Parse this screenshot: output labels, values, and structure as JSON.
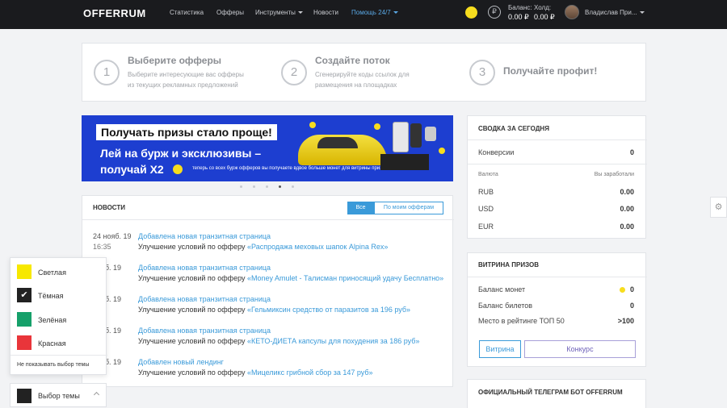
{
  "nav": {
    "logo": "OFFERRUM",
    "items": [
      {
        "label": "Статистика"
      },
      {
        "label": "Офферы"
      },
      {
        "label": "Инструменты"
      },
      {
        "label": "Новости"
      },
      {
        "label": "Помощь 24/7"
      }
    ],
    "balance_label": "Баланс:",
    "balance_value": "0.00 ₽",
    "hold_label": "Холд:",
    "hold_value": "0.00 ₽",
    "ruble_symbol": "₽",
    "user_name": "Владислав При...",
    "accent_color": "#5aa9e6"
  },
  "steps": [
    {
      "num": "1",
      "title": "Выберите офферы",
      "desc1": "Выберите интересующие вас офферы",
      "desc2": "из текущих рекламных предложений"
    },
    {
      "num": "2",
      "title": "Создайте поток",
      "desc1": "Сгенерируйте коды ссылок для",
      "desc2": "размещения на площадках"
    },
    {
      "num": "3",
      "title": "Получайте профит!",
      "desc1": "",
      "desc2": ""
    }
  ],
  "banner": {
    "headline": "Получать призы стало проще!",
    "line1": "Лей на бурж и эксклюзивы –",
    "line2": "получай X2",
    "small": "теперь со всех бурж офферов вы получаете вдвое больше монет для витрины призов",
    "slide_count": 5,
    "active_slide": 4
  },
  "news": {
    "title": "НОВОСТИ",
    "filter_all": "Все",
    "filter_mine": "По моим офферам",
    "items": [
      {
        "date": "24 нояб. 19",
        "time": "16:35",
        "title": "Добавлена новая транзитная страница",
        "prefix": "Улучшение условий по офферу ",
        "offer": "«Распродажа меховых шапок Alpina Rex»"
      },
      {
        "date": "нояб. 19",
        "time": "4",
        "title": "Добавлена новая транзитная страница",
        "prefix": "Улучшение условий по офферу ",
        "offer": "«Money Amulet - Талисман приносящий удачу Бесплатно»"
      },
      {
        "date": "нояб. 19",
        "time": "4",
        "title": "Добавлена новая транзитная страница",
        "prefix": "Улучшение условий по офферу ",
        "offer": "«Гельмиксин средство от паразитов за 196 руб»"
      },
      {
        "date": "нояб. 19",
        "time": "4",
        "title": "Добавлена новая транзитная страница",
        "prefix": "Улучшение условий по офферу ",
        "offer": "«КЕТО-ДИЕТА капсулы для похудения за 186 руб»"
      },
      {
        "date": "нояб. 19",
        "time": "4",
        "title": "Добавлен новый лендинг",
        "prefix": "Улучшение условий по офферу ",
        "offer": "«Мицеликс грибной сбор за 147 руб»"
      }
    ]
  },
  "summary": {
    "title": "СВОДКА ЗА СЕГОДНЯ",
    "conversions_label": "Конверсии",
    "conversions_value": "0",
    "currency_header": "Валюта",
    "earned_header": "Вы заработали",
    "rows": [
      {
        "currency": "RUB",
        "value": "0.00"
      },
      {
        "currency": "USD",
        "value": "0.00"
      },
      {
        "currency": "EUR",
        "value": "0.00"
      }
    ]
  },
  "prizes": {
    "title": "ВИТРИНА ПРИЗОВ",
    "coins_label": "Баланс монет",
    "coins_value": "0",
    "tickets_label": "Баланс билетов",
    "tickets_value": "0",
    "rating_label": "Место в рейтинге ТОП 50",
    "rating_value": ">100",
    "btn_showcase": "Витрина",
    "btn_contest": "Конкурс"
  },
  "telegram": {
    "title": "ОФИЦИАЛЬНЫЙ ТЕЛЕГРАМ БОТ OFFERRUM"
  },
  "theme": {
    "options": [
      {
        "label": "Светлая",
        "color": "#f7e800"
      },
      {
        "label": "Тёмная",
        "color": "#222222"
      },
      {
        "label": "Зелёная",
        "color": "#16a06a"
      },
      {
        "label": "Красная",
        "color": "#e9353a"
      }
    ],
    "checkmark": "✔",
    "hide_label": "Не показывать выбор темы",
    "select_label": "Выбор темы",
    "current_color": "#222222"
  }
}
